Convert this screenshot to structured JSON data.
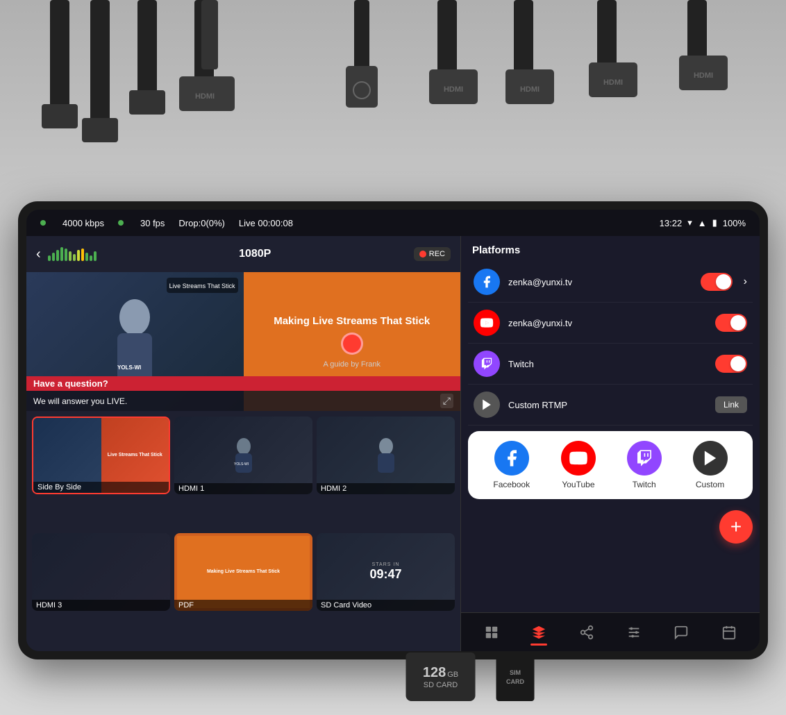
{
  "device": {
    "status_bar": {
      "bitrate": "4000 kbps",
      "fps": "30 fps",
      "drop": "Drop:0(0%)",
      "live": "Live 00:00:08",
      "time": "13:22",
      "battery": "100%"
    },
    "top_bar": {
      "resolution": "1080P",
      "rec_label": "REC"
    },
    "preview": {
      "lower_third_top": "Have a question?",
      "lower_third_bottom": "We will answer you LIVE.",
      "title_text": "Making Live Streams That Stick",
      "guide_text": "A guide by Frank"
    },
    "thumbnails": [
      {
        "label": "Side By Side",
        "active": true
      },
      {
        "label": "HDMI 1",
        "active": false
      },
      {
        "label": "HDMI 2",
        "active": false
      },
      {
        "label": "HDMI 3",
        "active": false
      },
      {
        "label": "PDF",
        "active": false
      },
      {
        "label": "SD Card Video",
        "active": false
      }
    ]
  },
  "platforms": {
    "header": "Platforms",
    "items": [
      {
        "name": "zenka@yunxi.tv",
        "platform": "facebook",
        "enabled": true,
        "has_chevron": true
      },
      {
        "name": "zenka@yunxi.tv",
        "platform": "youtube",
        "enabled": true,
        "has_chevron": false
      },
      {
        "name": "Twitch",
        "platform": "twitch",
        "enabled": true,
        "has_chevron": false
      },
      {
        "name": "Custom RTMP",
        "platform": "custom",
        "enabled": false,
        "has_chevron": false,
        "link_btn": "Link"
      }
    ],
    "picker": {
      "items": [
        {
          "label": "Facebook",
          "platform": "facebook"
        },
        {
          "label": "YouTube",
          "platform": "youtube"
        },
        {
          "label": "Twitch",
          "platform": "twitch"
        },
        {
          "label": "Custom",
          "platform": "custom"
        }
      ]
    },
    "add_btn": "+"
  },
  "bottom_nav": {
    "items": [
      {
        "icon": "⊞",
        "name": "grid"
      },
      {
        "icon": "◈",
        "name": "layers",
        "active": true
      },
      {
        "icon": "⬡",
        "name": "share"
      },
      {
        "icon": "⚙",
        "name": "settings"
      },
      {
        "icon": "💬",
        "name": "chat"
      },
      {
        "icon": "📅",
        "name": "calendar"
      }
    ]
  },
  "sd_card": {
    "size": "128GB",
    "label": "SD CARD"
  },
  "sim_card": {
    "label": "SIM\nCARD"
  }
}
